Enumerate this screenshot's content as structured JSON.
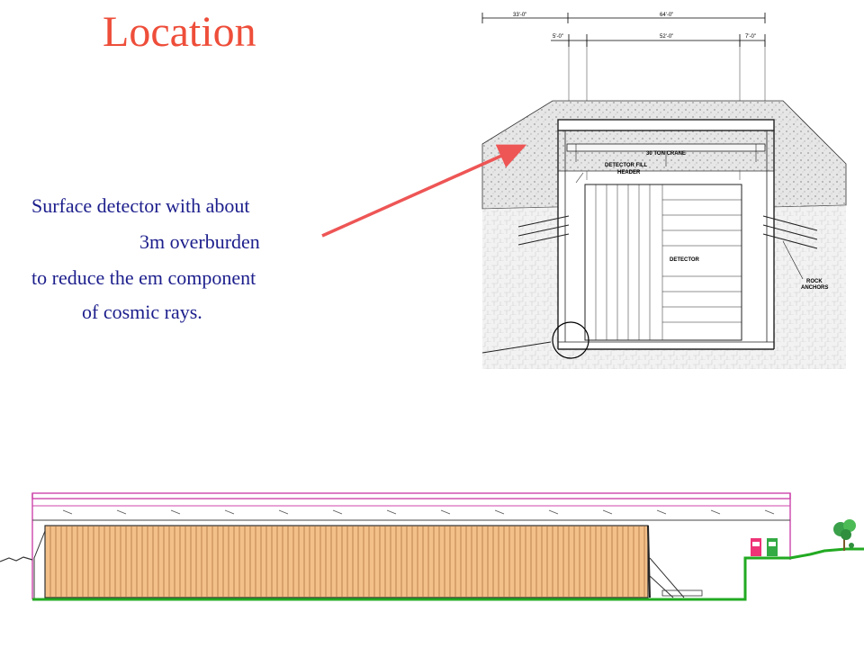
{
  "slide": {
    "title": "Location",
    "description_lines": [
      "Surface detector with about",
      "3m overburden",
      "to reduce the em component",
      "of cosmic rays."
    ]
  },
  "cross_section": {
    "dimensions": {
      "top_left": "33'-0\"",
      "top_right": "64'-0\"",
      "sub_left": "5'-0\"",
      "sub_mid": "52'-0\"",
      "sub_right": "7'-0\""
    },
    "labels": {
      "crane": "30 TON CRANE",
      "fill_header_1": "DETECTOR FILL",
      "fill_header_2": "HEADER",
      "detector": "DETECTOR",
      "rock_1": "ROCK",
      "rock_2": "ANCHORS"
    }
  },
  "colors": {
    "title": "#ee4e3a",
    "text": "#1c1e8c",
    "arrow": "#ee5555",
    "detector_fill": "#f3c089",
    "ground_line": "#22aa22",
    "roof": "#cc44aa"
  }
}
